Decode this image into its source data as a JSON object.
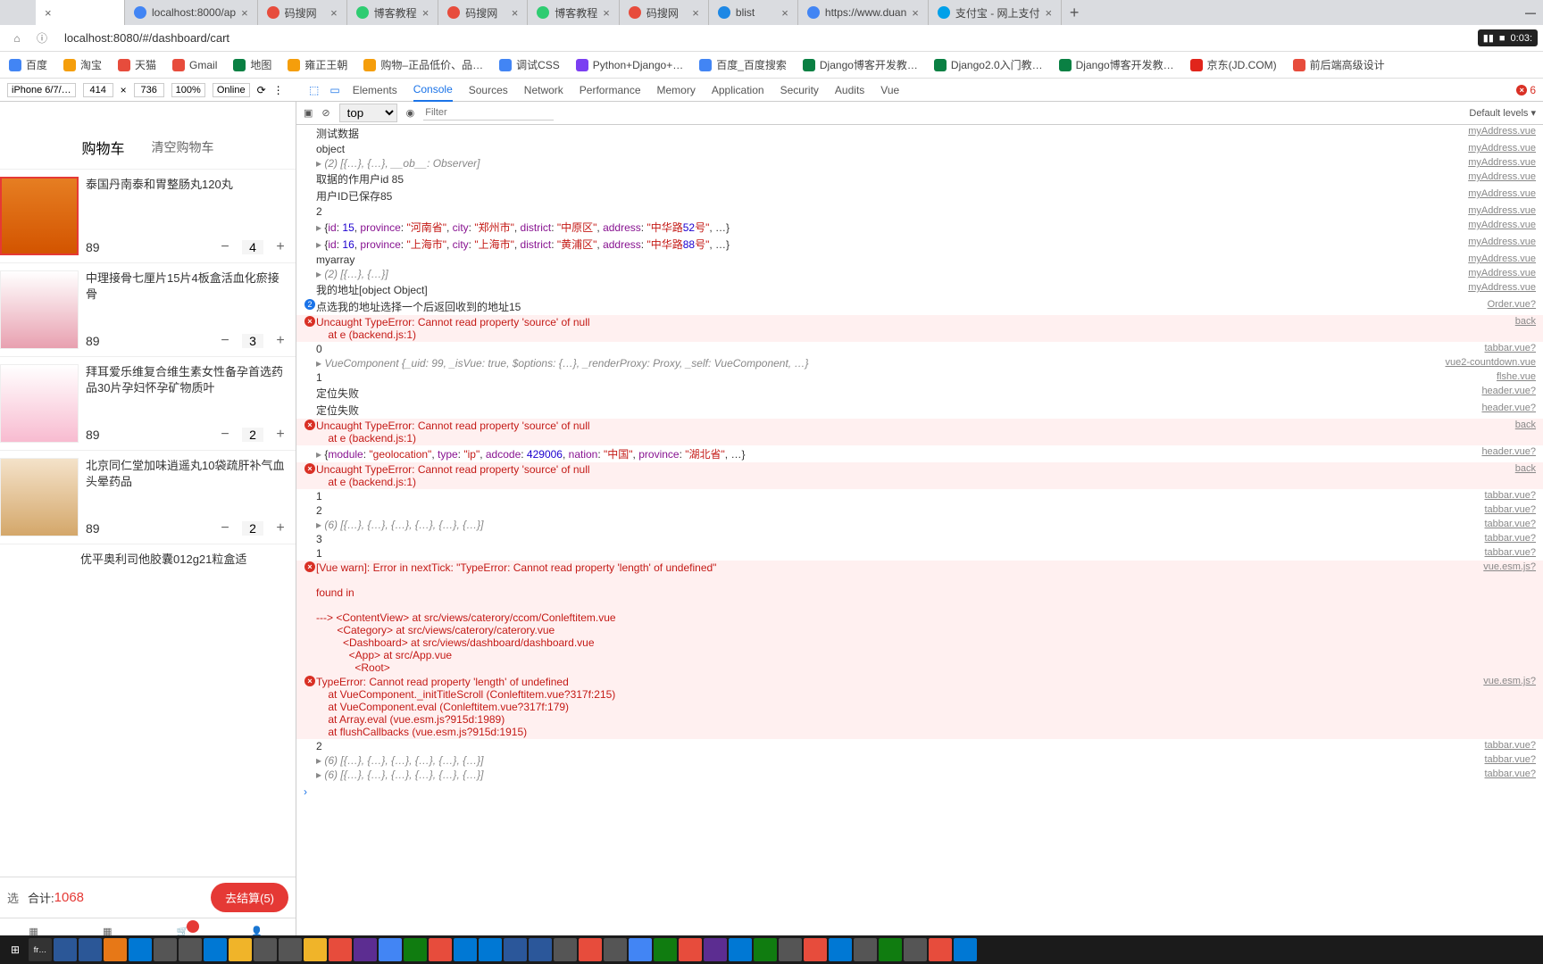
{
  "browser": {
    "tabs": [
      {
        "label": "",
        "close": "×"
      },
      {
        "label": "localhost:8000/ap",
        "close": "×"
      },
      {
        "label": "码搜网",
        "close": "×"
      },
      {
        "label": "博客教程",
        "close": "×"
      },
      {
        "label": "码搜网",
        "close": "×"
      },
      {
        "label": "博客教程",
        "close": "×"
      },
      {
        "label": "码搜网",
        "close": "×"
      },
      {
        "label": "blist",
        "close": "×"
      },
      {
        "label": "https://www.duan",
        "close": "×"
      },
      {
        "label": "支付宝 - 网上支付",
        "close": "×"
      }
    ],
    "url": "localhost:8080/#/dashboard/cart",
    "recording": "0:03:",
    "bookmarks": [
      "百度",
      "淘宝",
      "天猫",
      "Gmail",
      "地图",
      "雍正王朝",
      "购物–正品低价、品…",
      "调试CSS",
      "Python+Django+…",
      "百度_百度搜索",
      "Django博客开发教…",
      "Django2.0入门教…",
      "Django博客开发教…",
      "京东(JD.COM)",
      "前后端高级设计"
    ]
  },
  "device_bar": {
    "device": "iPhone 6/7/…",
    "w": "414",
    "h": "736",
    "zoom": "100%",
    "throttle": "Online"
  },
  "devtools": {
    "tabs": [
      "Elements",
      "Console",
      "Sources",
      "Network",
      "Performance",
      "Memory",
      "Application",
      "Security",
      "Audits",
      "Vue"
    ],
    "active": "Console",
    "err_badge": "6",
    "context": "top",
    "filter_placeholder": "Filter",
    "levels": "Default levels"
  },
  "mobile": {
    "title": "购物车",
    "clear": "清空购物车",
    "items": [
      {
        "name": "泰国丹南泰和胃整肠丸120丸",
        "price": "89",
        "qty": "4"
      },
      {
        "name": "中理接骨七厘片15片4板盒活血化瘀接骨",
        "price": "89",
        "qty": "3"
      },
      {
        "name": "拜耳爱乐维复合维生素女性备孕首选药品30片孕妇怀孕矿物质叶",
        "price": "89",
        "qty": "2"
      },
      {
        "name": "北京同仁堂加味逍遥丸10袋疏肝补气血头晕药品",
        "price": "89",
        "qty": "2"
      },
      {
        "name": "优平奥利司他胶囊012g21粒盒适",
        "price": "",
        "qty": ""
      }
    ],
    "footer": {
      "select": "选",
      "total_label": "合计:",
      "total": "1068",
      "checkout": "去结算(5)"
    },
    "tabbar": [
      "页",
      "分类",
      "购物车",
      "我的"
    ]
  },
  "console": [
    {
      "t": "log",
      "body": "测试数据",
      "src": "myAddress.vue"
    },
    {
      "t": "log",
      "body": "object",
      "src": "myAddress.vue"
    },
    {
      "t": "obj",
      "body": "(2) [{…}, {…}, __ob__: Observer]",
      "src": "myAddress.vue"
    },
    {
      "t": "log",
      "body": "取据的作用户id 85",
      "src": "myAddress.vue"
    },
    {
      "t": "log",
      "body": "用户ID已保存85",
      "src": "myAddress.vue"
    },
    {
      "t": "log",
      "body": "2",
      "src": "myAddress.vue"
    },
    {
      "t": "objc",
      "body": "{id: 15, province: \"河南省\", city: \"郑州市\", district: \"中原区\", address: \"中华路52号\", …}",
      "src": "myAddress.vue"
    },
    {
      "t": "objc",
      "body": "{id: 16, province: \"上海市\", city: \"上海市\", district: \"黄浦区\", address: \"中华路88号\", …}",
      "src": "myAddress.vue"
    },
    {
      "t": "log",
      "body": "myarray",
      "src": "myAddress.vue"
    },
    {
      "t": "obj",
      "body": "(2) [{…}, {…}]",
      "src": "myAddress.vue"
    },
    {
      "t": "log",
      "body": "我的地址[object Object]",
      "src": "myAddress.vue"
    },
    {
      "t": "info",
      "body": "点选我的地址选择一个后返回收到的地址15",
      "src": "Order.vue?"
    },
    {
      "t": "err",
      "body": "Uncaught TypeError: Cannot read property 'source' of null\n    at e (backend.js:1)",
      "src": "back"
    },
    {
      "t": "log",
      "body": "0",
      "src": "tabbar.vue?"
    },
    {
      "t": "obj",
      "body": "VueComponent {_uid: 99, _isVue: true, $options: {…}, _renderProxy: Proxy, _self: VueComponent, …}",
      "src": "vue2-countdown.vue"
    },
    {
      "t": "log",
      "body": "1",
      "src": "flshe.vue"
    },
    {
      "t": "log",
      "body": "定位失败",
      "src": "header.vue?"
    },
    {
      "t": "log",
      "body": "定位失败",
      "src": "header.vue?"
    },
    {
      "t": "err",
      "body": "Uncaught TypeError: Cannot read property 'source' of null\n    at e (backend.js:1)",
      "src": "back"
    },
    {
      "t": "objc",
      "body": "{module: \"geolocation\", type: \"ip\", adcode: 429006, nation: \"中国\", province: \"湖北省\", …}",
      "src": "header.vue?"
    },
    {
      "t": "err",
      "body": "Uncaught TypeError: Cannot read property 'source' of null\n    at e (backend.js:1)",
      "src": "back"
    },
    {
      "t": "log",
      "body": "1",
      "src": "tabbar.vue?"
    },
    {
      "t": "log",
      "body": "2",
      "src": "tabbar.vue?"
    },
    {
      "t": "obj",
      "body": "(6) [{…}, {…}, {…}, {…}, {…}, {…}]",
      "src": "tabbar.vue?"
    },
    {
      "t": "log",
      "body": "3",
      "src": "tabbar.vue?"
    },
    {
      "t": "log",
      "body": "1",
      "src": "tabbar.vue?"
    },
    {
      "t": "errm",
      "body": "[Vue warn]: Error in nextTick: \"TypeError: Cannot read property 'length' of undefined\"\n\nfound in\n\n---> <ContentView> at src/views/caterory/ccom/Conleftitem.vue\n       <Category> at src/views/caterory/caterory.vue\n         <Dashboard> at src/views/dashboard/dashboard.vue\n           <App> at src/App.vue\n             <Root>",
      "src": "vue.esm.js?"
    },
    {
      "t": "errm",
      "body": "TypeError: Cannot read property 'length' of undefined\n    at VueComponent._initTitleScroll (Conleftitem.vue?317f:215)\n    at VueComponent.eval (Conleftitem.vue?317f:179)\n    at Array.eval (vue.esm.js?915d:1989)\n    at flushCallbacks (vue.esm.js?915d:1915)",
      "src": "vue.esm.js?"
    },
    {
      "t": "log",
      "body": "2",
      "src": "tabbar.vue?"
    },
    {
      "t": "obj",
      "body": "(6) [{…}, {…}, {…}, {…}, {…}, {…}]",
      "src": "tabbar.vue?"
    },
    {
      "t": "obj",
      "body": "(6) [{…}, {…}, {…}, {…}, {…}, {…}]",
      "src": "tabbar.vue?"
    }
  ],
  "taskbar_label": "fr…"
}
